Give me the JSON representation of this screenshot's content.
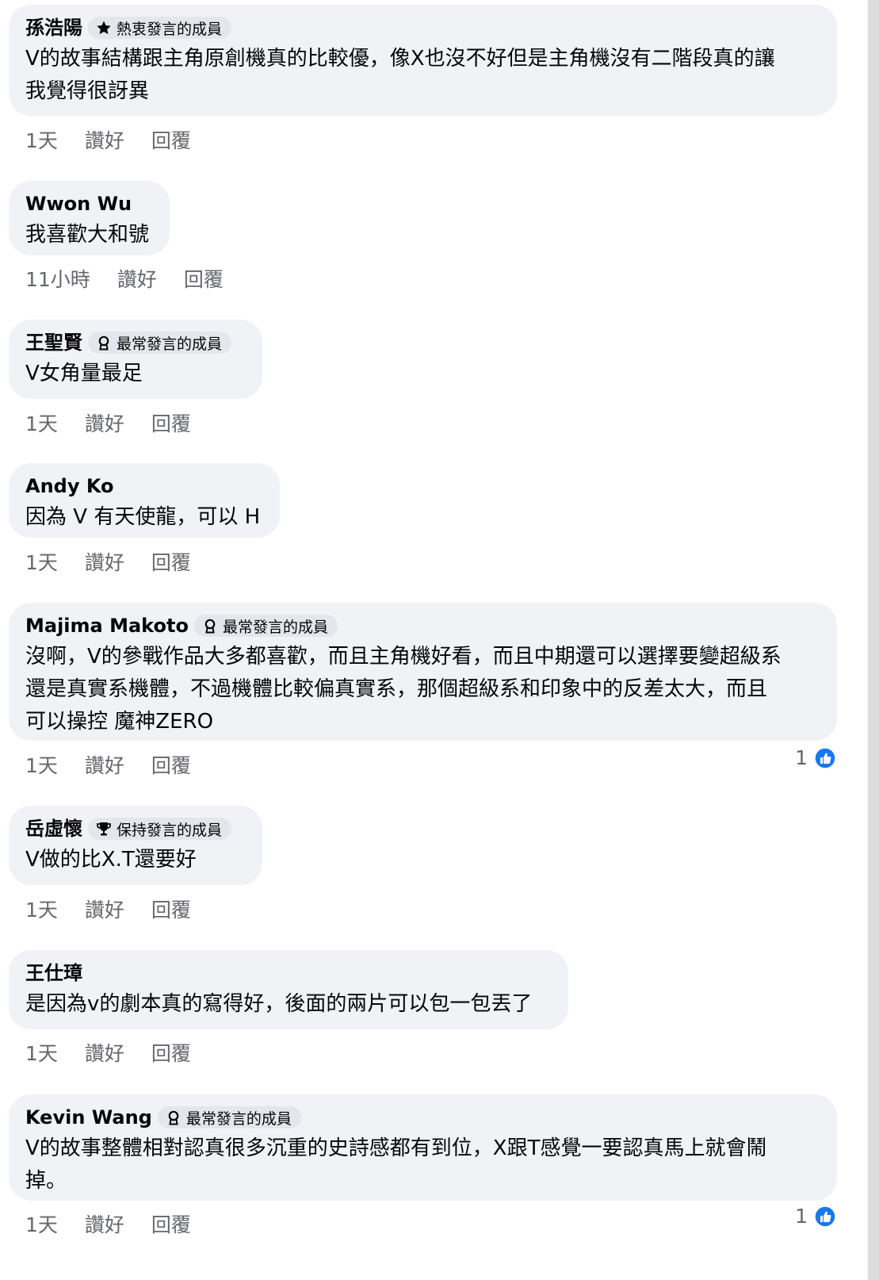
{
  "comments": [
    {
      "author": "孫浩陽",
      "badge": {
        "icon": "star-icon",
        "label": "熱衷發言的成員"
      },
      "lines": [
        "V的故事結構跟主角原創機真的比較優，像X也沒不好但是主角機沒有二階段真的讓",
        "我覺得很訝異"
      ],
      "time": "1天",
      "like": "讚好",
      "reply": "回覆"
    },
    {
      "author": "Wwon Wu",
      "lines": [
        "我喜歡大和號"
      ],
      "time": "11小時",
      "like": "讚好",
      "reply": "回覆"
    },
    {
      "author": "王聖賢",
      "badge": {
        "icon": "award-icon",
        "label": "最常發言的成員"
      },
      "lines": [
        "V女角量最足"
      ],
      "time": "1天",
      "like": "讚好",
      "reply": "回覆"
    },
    {
      "author": "Andy Ko",
      "lines": [
        "因為 V 有天使龍，可以 H"
      ],
      "time": "1天",
      "like": "讚好",
      "reply": "回覆"
    },
    {
      "author": "Majima Makoto",
      "badge": {
        "icon": "award-icon",
        "label": "最常發言的成員"
      },
      "lines": [
        "沒啊，V的參戰作品大多都喜歡，而且主角機好看，而且中期還可以選擇要變超級系",
        "還是真實系機體，不過機體比較偏真實系，那個超級系和印象中的反差太大，而且",
        "可以操控 魔神ZERO"
      ],
      "time": "1天",
      "like": "讚好",
      "reply": "回覆",
      "reaction_count": "1"
    },
    {
      "author": "岳虛懷",
      "badge": {
        "icon": "trophy-icon",
        "label": "保持發言的成員"
      },
      "lines": [
        "V做的比X.T還要好"
      ],
      "time": "1天",
      "like": "讚好",
      "reply": "回覆"
    },
    {
      "author": "王仕璋",
      "lines": [
        "是因為v的劇本真的寫得好，後面的兩片可以包一包丟了"
      ],
      "time": "1天",
      "like": "讚好",
      "reply": "回覆"
    },
    {
      "author": "Kevin Wang",
      "badge": {
        "icon": "award-icon",
        "label": "最常發言的成員"
      },
      "lines": [
        "V的故事整體相對認真很多沉重的史詩感都有到位，X跟T感覺一要認真馬上就會鬧",
        "掉。"
      ],
      "time": "1天",
      "like": "讚好",
      "reply": "回覆",
      "reaction_count": "1"
    }
  ],
  "colors": {
    "bubble": "#f0f2f5",
    "badge": "#e4e6eb",
    "meta_text": "#65676b",
    "like_blue": "#1877f2"
  }
}
